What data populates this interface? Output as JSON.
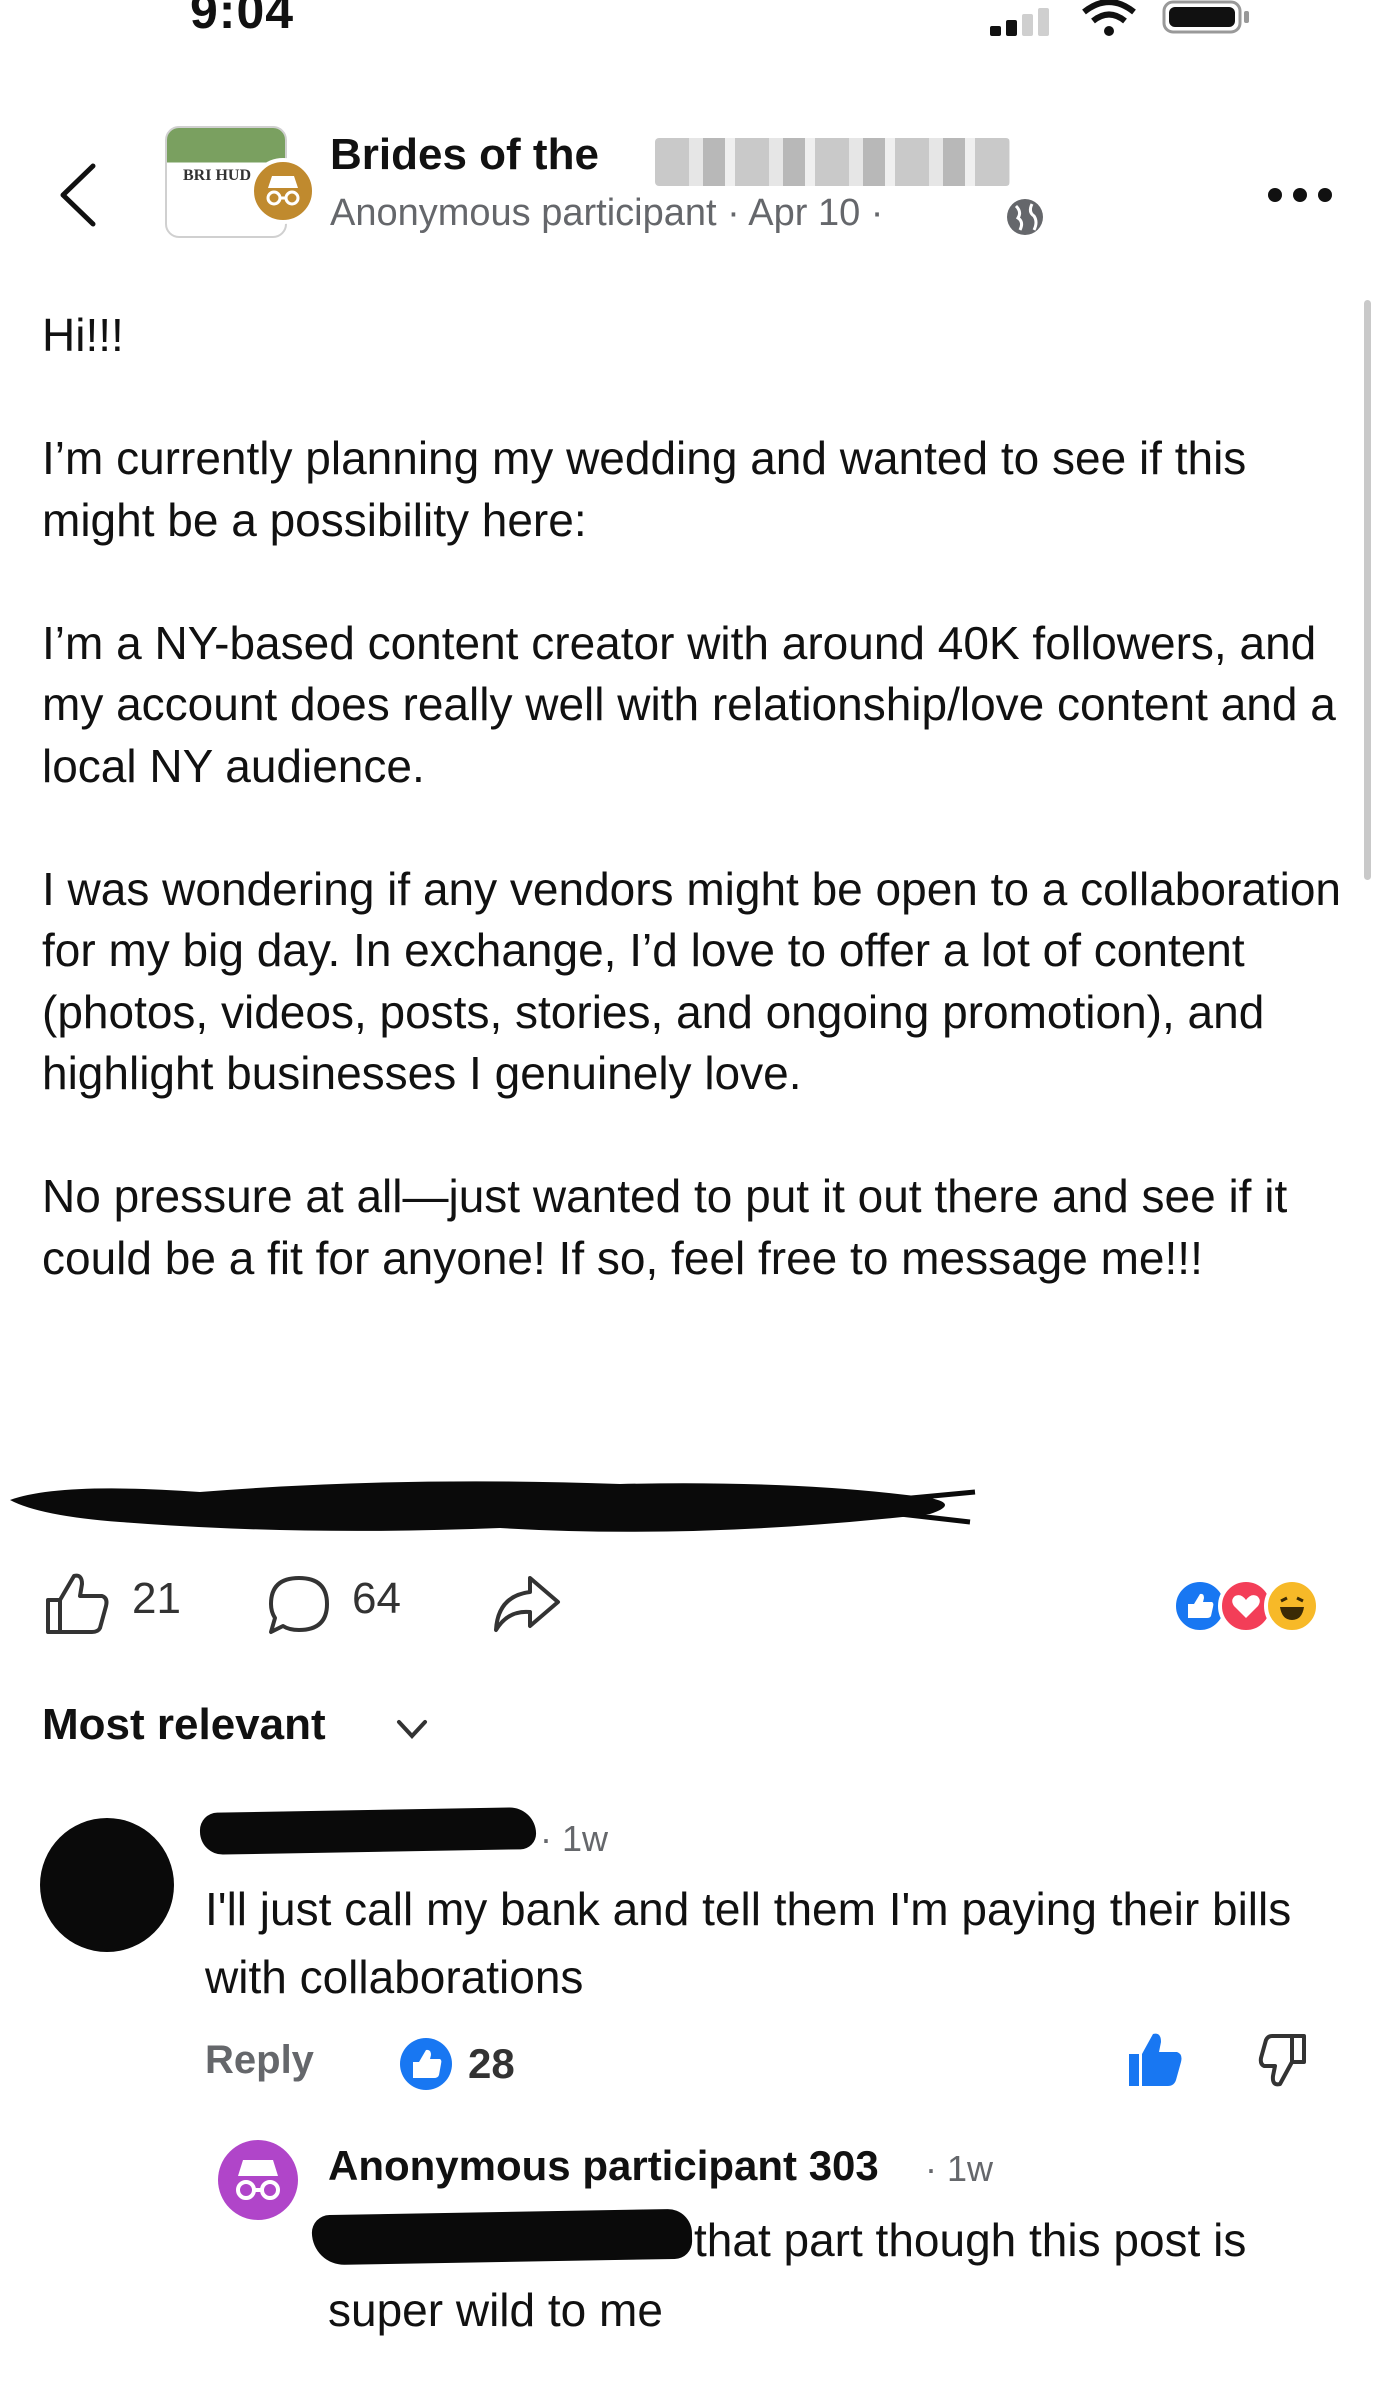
{
  "status_bar": {
    "time": "9:04"
  },
  "header": {
    "group_name": "Brides of the",
    "author": "Anonymous participant",
    "date": "Apr 10",
    "separator": "·",
    "avatar_text": "BRI HUD"
  },
  "post": {
    "paragraphs": [
      "Hi!!!",
      "I’m currently planning my wedding and wanted to see if this might be a possibility here:",
      "I’m a NY-based content creator with around 40K followers, and my account does really well with relationship/love content and a local NY audience.",
      "I was wondering if any vendors might be open to a collaboration for my big day. In exchange, I’d love to offer a lot of content (photos, videos, posts, stories, and ongoing promotion), and highlight businesses I genuinely love.",
      "No pressure at all—just wanted to put it out there and see if it could be a fit for anyone! If so, feel free to message me!!!"
    ]
  },
  "actions": {
    "like_count": "21",
    "comment_count": "64",
    "reactions": [
      "like",
      "love",
      "haha"
    ]
  },
  "sort": {
    "label": "Most relevant"
  },
  "comments": [
    {
      "time": "· 1w",
      "text": "I'll just call my bank and tell them I'm paying their bills with collaborations",
      "reply_label": "Reply",
      "like_count": "28"
    },
    {
      "author": "Anonymous participant 303",
      "time": "· 1w",
      "text": "that part though this post is super wild to me"
    }
  ],
  "colors": {
    "accent_blue": "#1877f2",
    "love_red": "#f33e58",
    "haha_yellow": "#f7b928",
    "meta_gray": "#65676b",
    "anon_purple": "#b045c9"
  },
  "icons": [
    "back-icon",
    "globe-icon",
    "more-icon",
    "like-icon",
    "comment-icon",
    "share-icon",
    "chevron-down-icon",
    "thumbs-up-icon",
    "thumbs-down-icon",
    "incognito-icon"
  ]
}
